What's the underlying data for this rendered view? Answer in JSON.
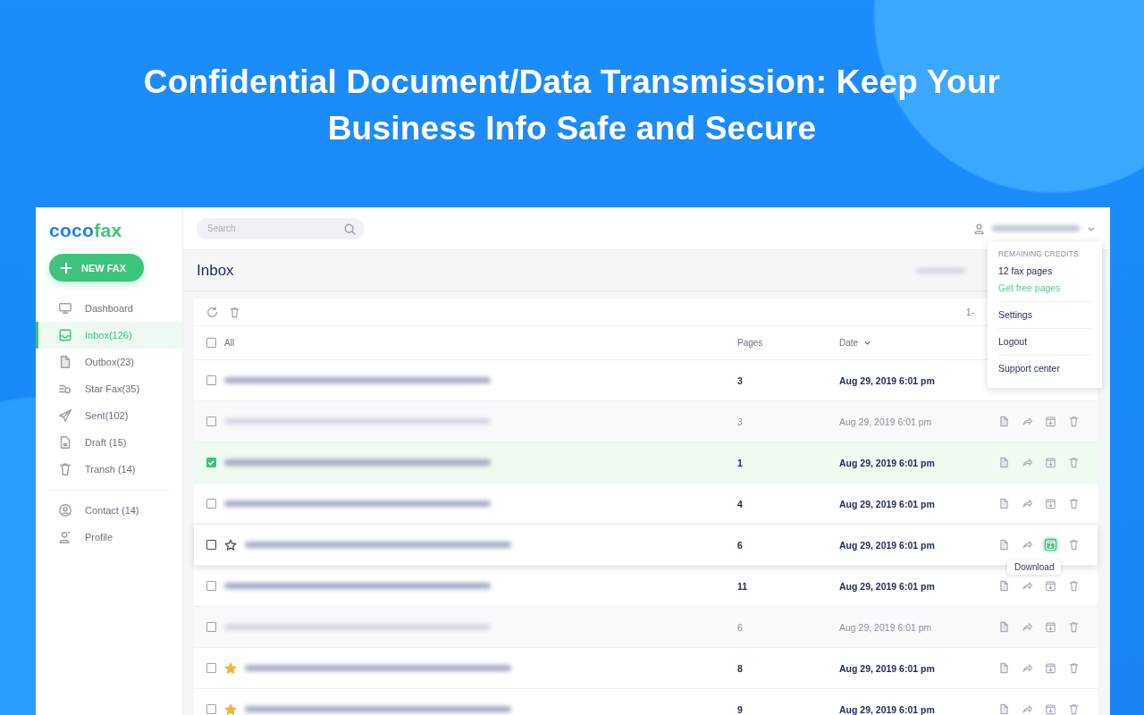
{
  "headline": "Confidential Document/Data Transmission: Keep Your Business Info Safe and Secure",
  "app": {
    "logo": {
      "prefix": "coco",
      "suffix": "fax"
    },
    "new_fax_button": {
      "label": "NEW FAX"
    },
    "sidebar": {
      "groups": [
        [
          {
            "label": "Dashboard",
            "selected": false
          },
          {
            "label": "Inbox(126)",
            "selected": true
          },
          {
            "label": "Outbox(23)",
            "selected": false
          },
          {
            "label": "Star Fax(35)",
            "selected": false
          },
          {
            "label": "Sent(102)",
            "selected": false
          },
          {
            "label": "Draft (15)",
            "selected": false
          },
          {
            "label": "Transh (14)",
            "selected": false
          }
        ],
        [
          {
            "label": "Contact (14)",
            "selected": false
          },
          {
            "label": "Profile",
            "selected": false
          }
        ]
      ]
    },
    "search": {
      "placeholder": "Search"
    },
    "account_menu": {
      "section_label": "REMAINING CREDITS",
      "credits": "12 fax pages",
      "link": "Get free pages",
      "items": [
        "Settings",
        "Logout",
        "Support center"
      ]
    },
    "page_title": "Inbox",
    "pagination": "1-",
    "table": {
      "select_all": {
        "label": "All",
        "checked": false
      },
      "columns": [
        {
          "label": "Pages",
          "sortable": false
        },
        {
          "label": "Date",
          "sortable": true
        }
      ],
      "rows": [
        {
          "pages": "3",
          "date": "Aug 29, 2019 6:01 pm",
          "unread": true,
          "checked": false,
          "starred": false,
          "hovered": false,
          "actions_shown": false
        },
        {
          "pages": "3",
          "date": "Aug 29, 2019 6:01 pm",
          "unread": false,
          "checked": false,
          "starred": false,
          "hovered": false,
          "actions_shown": true
        },
        {
          "pages": "1",
          "date": "Aug 29, 2019 6:01 pm",
          "unread": true,
          "checked": true,
          "starred": false,
          "hovered": false,
          "actions_shown": true
        },
        {
          "pages": "4",
          "date": "Aug 29, 2019 6:01 pm",
          "unread": true,
          "checked": false,
          "starred": false,
          "hovered": false,
          "actions_shown": true
        },
        {
          "pages": "6",
          "date": "Aug 29, 2019 6:01 pm",
          "unread": true,
          "checked": false,
          "starred": false,
          "hovered": true,
          "actions_shown": true,
          "tooltip": "Download"
        },
        {
          "pages": "11",
          "date": "Aug 29, 2019 6:01 pm",
          "unread": true,
          "checked": false,
          "starred": false,
          "hovered": false,
          "actions_shown": true
        },
        {
          "pages": "6",
          "date": "Aug 29, 2019 6:01 pm",
          "unread": false,
          "checked": false,
          "starred": false,
          "hovered": false,
          "actions_shown": true
        },
        {
          "pages": "8",
          "date": "Aug 29, 2019 6:01 pm",
          "unread": true,
          "checked": false,
          "starred": true,
          "hovered": false,
          "actions_shown": true
        },
        {
          "pages": "9",
          "date": "Aug 29, 2019 6:01 pm",
          "unread": true,
          "checked": false,
          "starred": true,
          "hovered": false,
          "actions_shown": true
        }
      ]
    }
  }
}
